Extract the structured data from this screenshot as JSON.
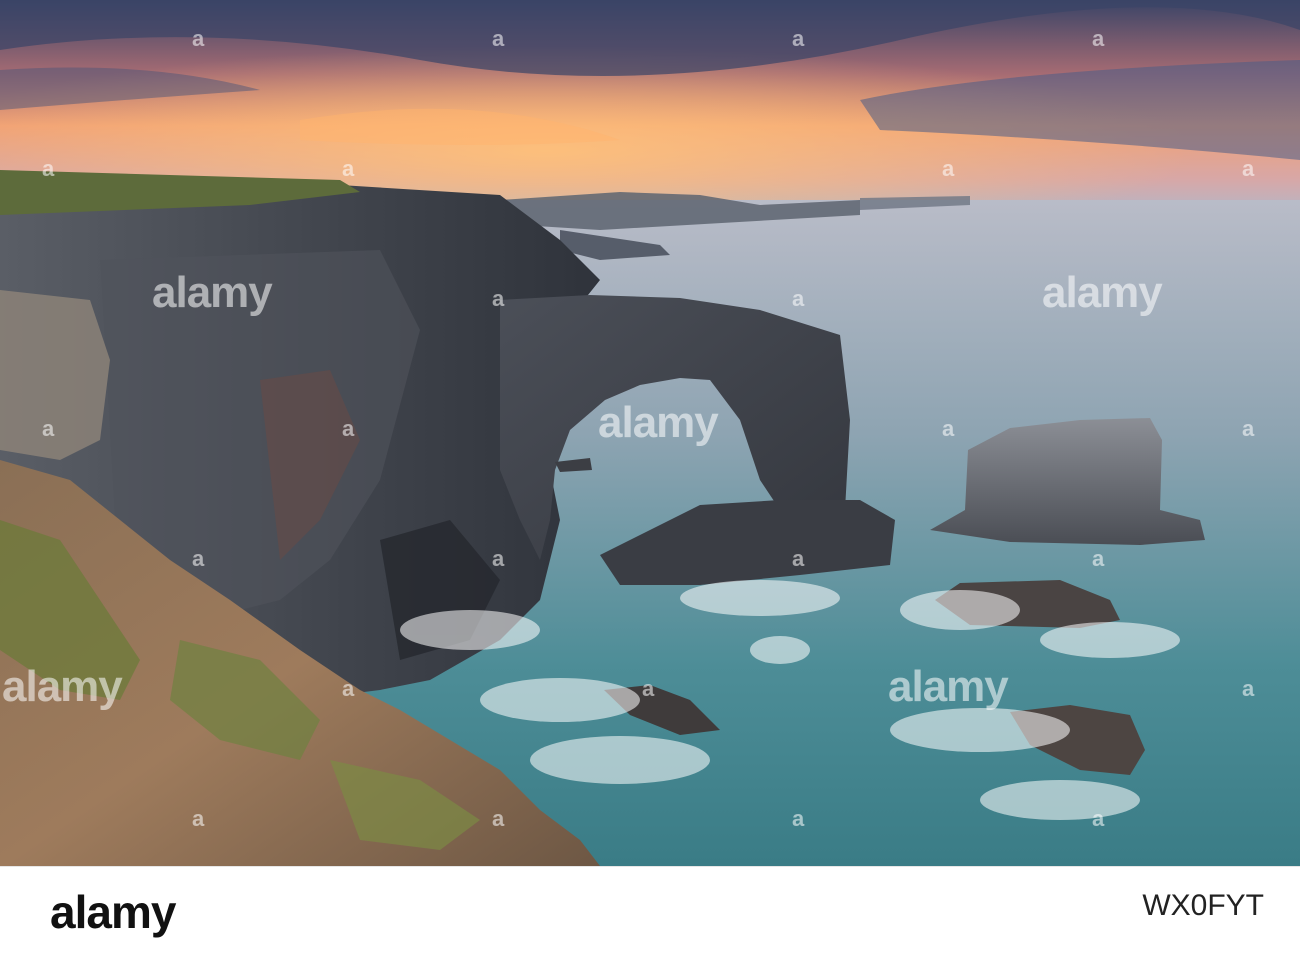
{
  "watermark": {
    "brand": "alamy",
    "big_text": "alamy",
    "small_text": "a"
  },
  "footer": {
    "logo_text": "alamy",
    "image_id": "WX0FYT"
  },
  "colors": {
    "sky_top": "#39476a",
    "sky_glow": "#f29a6a",
    "sea": "#6f8fa0",
    "sea_near": "#3f8a8f",
    "cliff": "#4a4d52",
    "grass": "#6b7e3e"
  }
}
